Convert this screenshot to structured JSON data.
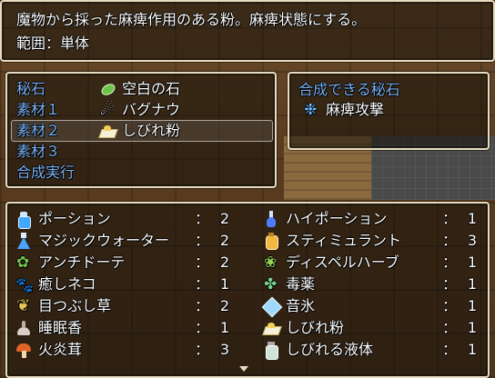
{
  "help": {
    "line1": "魔物から採った麻痺作用のある粉。麻痺状態にする。",
    "line2": "範囲：単体"
  },
  "commands": {
    "secret": "秘石",
    "material1": "素材１",
    "material2": "素材２",
    "material3": "素材３",
    "execute": "合成実行"
  },
  "slots": {
    "slot1": "空白の石",
    "slot2": "バグナウ",
    "slot3": "しびれ粉"
  },
  "result": {
    "title": "合成できる秘石",
    "item": "麻痺攻撃"
  },
  "colon": "：",
  "items_left": [
    {
      "icon": "potion-icon",
      "name": "ポーション",
      "count": "2"
    },
    {
      "icon": "magic-water-icon",
      "name": "マジックウォーター",
      "count": "2"
    },
    {
      "icon": "antidote-icon",
      "name": "アンチドーテ",
      "count": "2"
    },
    {
      "icon": "healing-cat-icon",
      "name": "癒しネコ",
      "count": "1"
    },
    {
      "icon": "eye-drop-herb-icon",
      "name": "目つぶし草",
      "count": "2"
    },
    {
      "icon": "sleep-incense-icon",
      "name": "睡眠香",
      "count": "1"
    },
    {
      "icon": "fire-mushroom-icon",
      "name": "火炎茸",
      "count": "3"
    }
  ],
  "items_right": [
    {
      "icon": "hi-potion-icon",
      "name": "ハイポーション",
      "count": "1"
    },
    {
      "icon": "stimulant-icon",
      "name": "スティミュラント",
      "count": "3"
    },
    {
      "icon": "dispel-herb-icon",
      "name": "ディスペルハーブ",
      "count": "1"
    },
    {
      "icon": "poison-herb-icon",
      "name": "毒薬",
      "count": "1"
    },
    {
      "icon": "sound-ice-icon",
      "name": "音氷",
      "count": "1"
    },
    {
      "icon": "paralysis-powder-icon",
      "name": "しびれ粉",
      "count": "1"
    },
    {
      "icon": "paralysis-liquid-icon",
      "name": "しびれる液体",
      "count": "1"
    }
  ],
  "colors": {
    "system_text": "#7ab0f0",
    "window_border": "#e8dcc0"
  }
}
